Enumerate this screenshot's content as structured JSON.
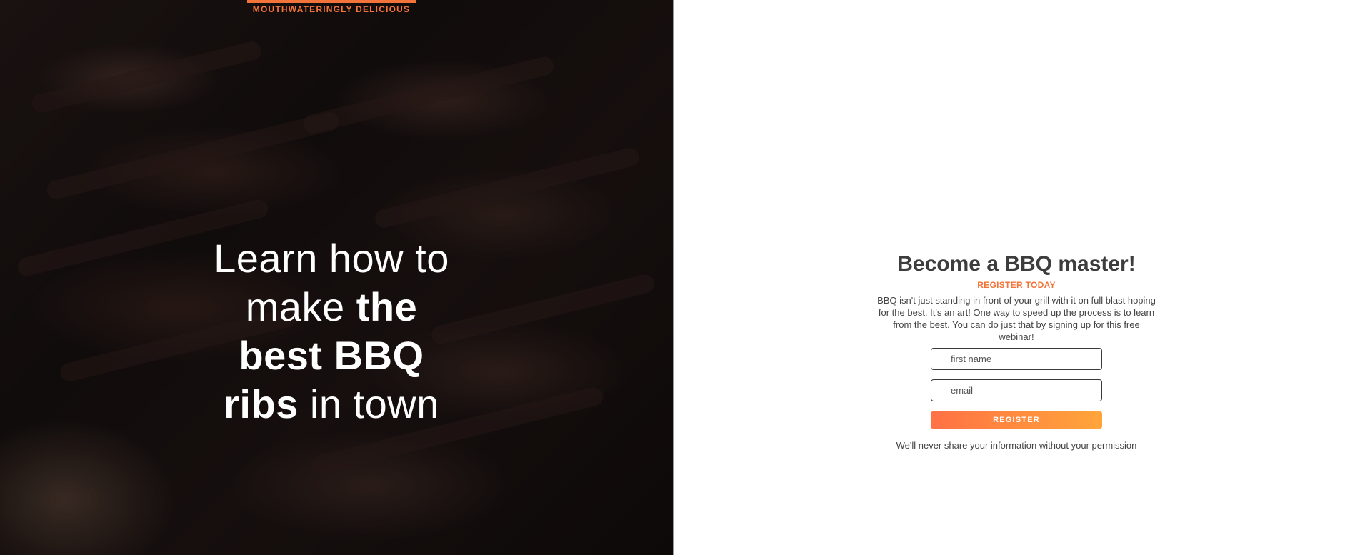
{
  "hero": {
    "brand": "MOUTHWATERINGLY DELICIOUS",
    "headline": {
      "line1": "Learn how to",
      "line2_regular": "make ",
      "line2_bold": "the",
      "line3_bold": "best BBQ",
      "line4_bold": "ribs",
      "line4_regular": " in town"
    }
  },
  "form": {
    "title": "Become a BBQ master!",
    "subtitle": "REGISTER TODAY",
    "description": "BBQ isn't just standing in front of your grill with it on full blast hoping for the best. It's an art! One way to speed up the process is to learn from the best. You can do just that by signing up for this free webinar!",
    "first_name_placeholder": "first name",
    "email_placeholder": "email",
    "register_label": "REGISTER",
    "privacy_note": "We'll never share your information without your permission"
  },
  "colors": {
    "accent": "#f2743a",
    "button_gradient_start": "#ff7145",
    "button_gradient_end": "#ffa53a",
    "title": "#3d3d3d"
  }
}
